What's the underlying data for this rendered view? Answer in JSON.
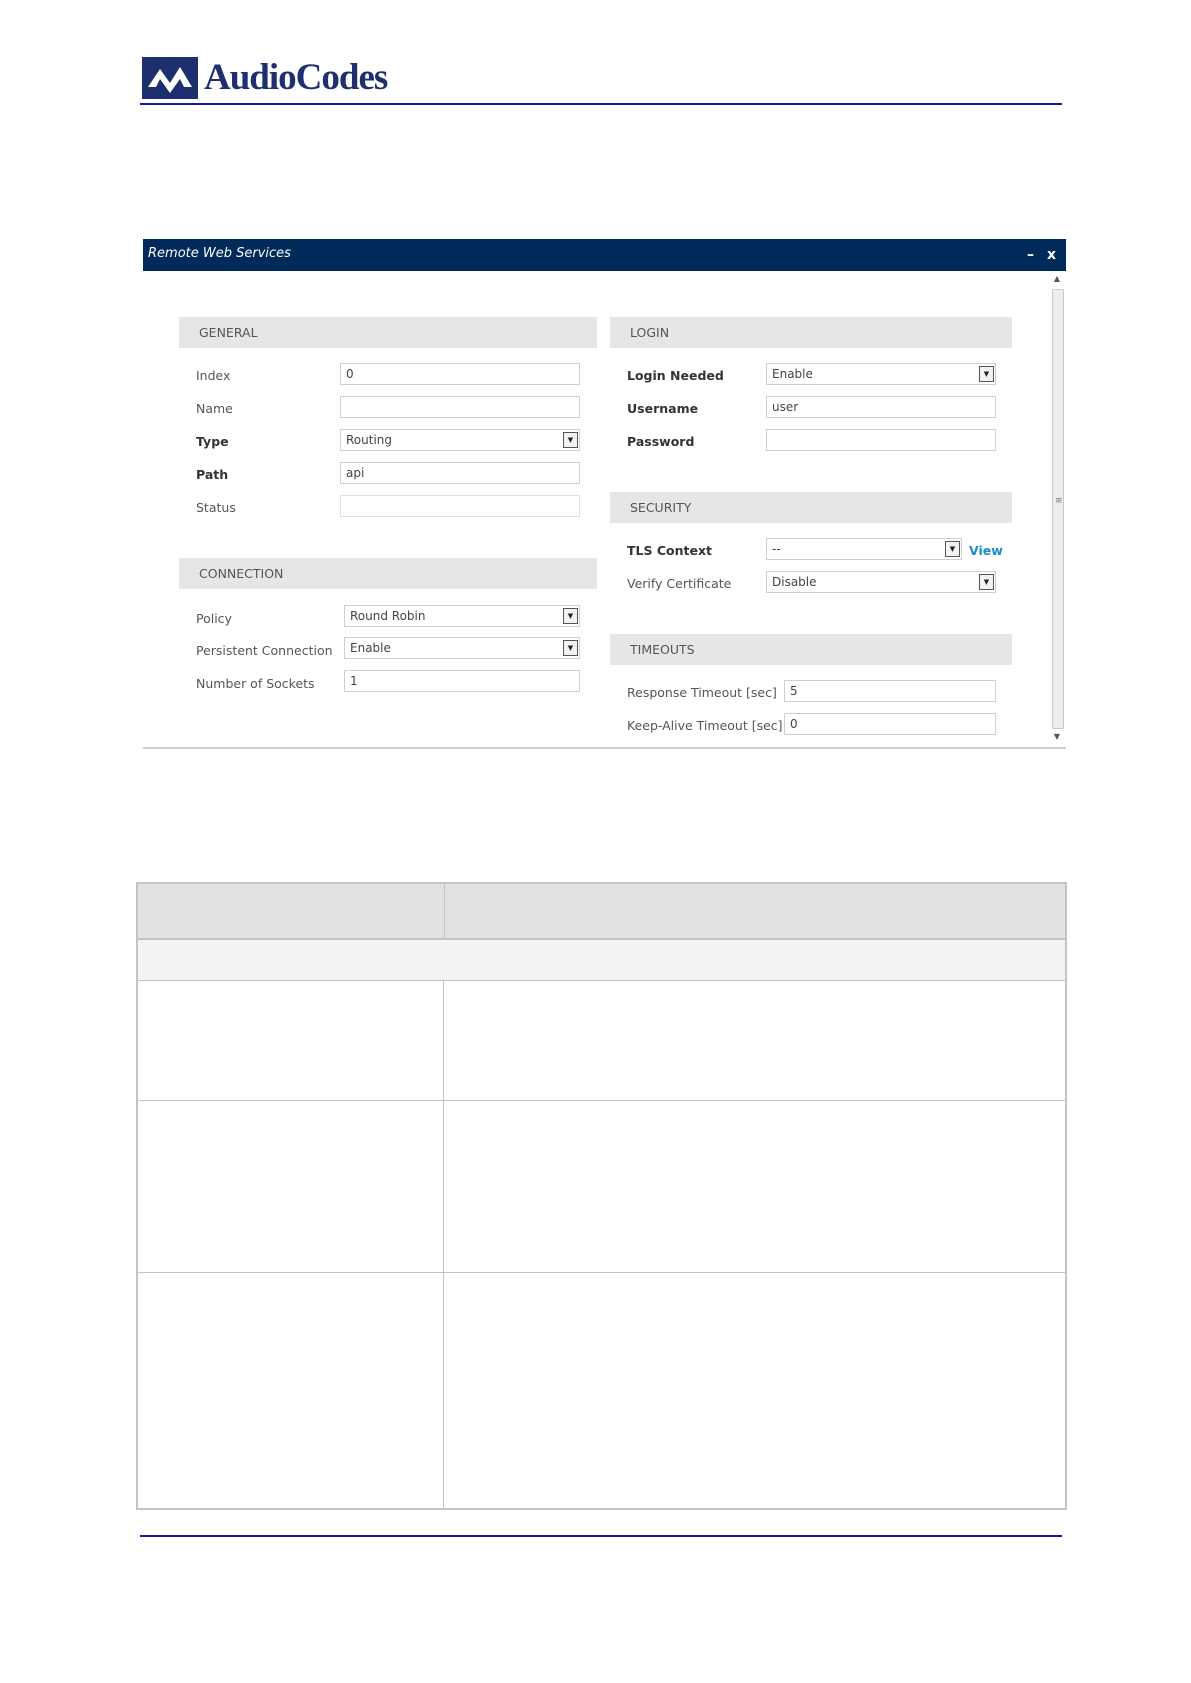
{
  "header": {
    "logo_text": "AudioCodes",
    "brand_color": "#1d2f6f",
    "rule_color": "#1a1a9a"
  },
  "dialog": {
    "title": "Remote Web Services",
    "minimize_label": "–",
    "close_label": "x",
    "titlebar_color": "#002a5a",
    "general": {
      "heading": "GENERAL",
      "index": {
        "label": "Index",
        "value": "0"
      },
      "name": {
        "label": "Name",
        "value": ""
      },
      "type": {
        "label": "Type",
        "value": "Routing"
      },
      "path": {
        "label": "Path",
        "value": "api"
      },
      "status": {
        "label": "Status",
        "value": ""
      }
    },
    "connection": {
      "heading": "CONNECTION",
      "policy": {
        "label": "Policy",
        "value": "Round Robin"
      },
      "persistent": {
        "label": "Persistent Connection",
        "value": "Enable"
      },
      "sockets": {
        "label": "Number of Sockets",
        "value": "1"
      }
    },
    "login": {
      "heading": "LOGIN",
      "login_needed": {
        "label": "Login Needed",
        "value": "Enable"
      },
      "username": {
        "label": "Username",
        "value": "user"
      },
      "password": {
        "label": "Password",
        "value": ""
      }
    },
    "security": {
      "heading": "SECURITY",
      "tls_context": {
        "label": "TLS Context",
        "value": "--",
        "link": "View"
      },
      "verify_cert": {
        "label": "Verify Certificate",
        "value": "Disable"
      }
    },
    "timeouts": {
      "heading": "TIMEOUTS",
      "response": {
        "label": "Response Timeout [sec]",
        "value": "5"
      },
      "keepalive": {
        "label": "Keep-Alive Timeout [sec]",
        "value": "0"
      }
    }
  }
}
